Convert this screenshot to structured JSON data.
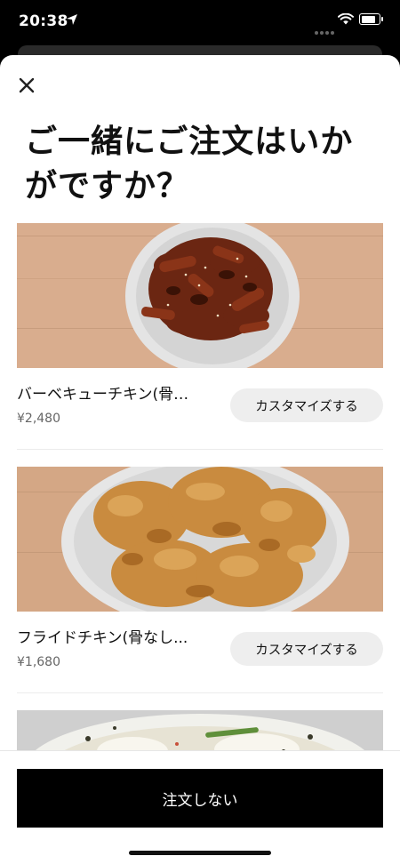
{
  "status_bar": {
    "time": "20:38"
  },
  "sheet": {
    "title": "ご一緒にご注文はいかがですか？",
    "items": [
      {
        "name": "バーベキューチキン(骨…",
        "price": "¥2,480",
        "button_label": "カスタマイズする"
      },
      {
        "name": "フライドチキン(骨なし...",
        "price": "¥1,680",
        "button_label": "カスタマイズする"
      }
    ],
    "decline_label": "注文しない"
  },
  "colors": {
    "primary_button": "#000000",
    "secondary_button": "#EEEEEE",
    "price_text": "#666666"
  },
  "icons": [
    "location-arrow-icon",
    "wifi-icon",
    "battery-icon",
    "close-icon"
  ]
}
